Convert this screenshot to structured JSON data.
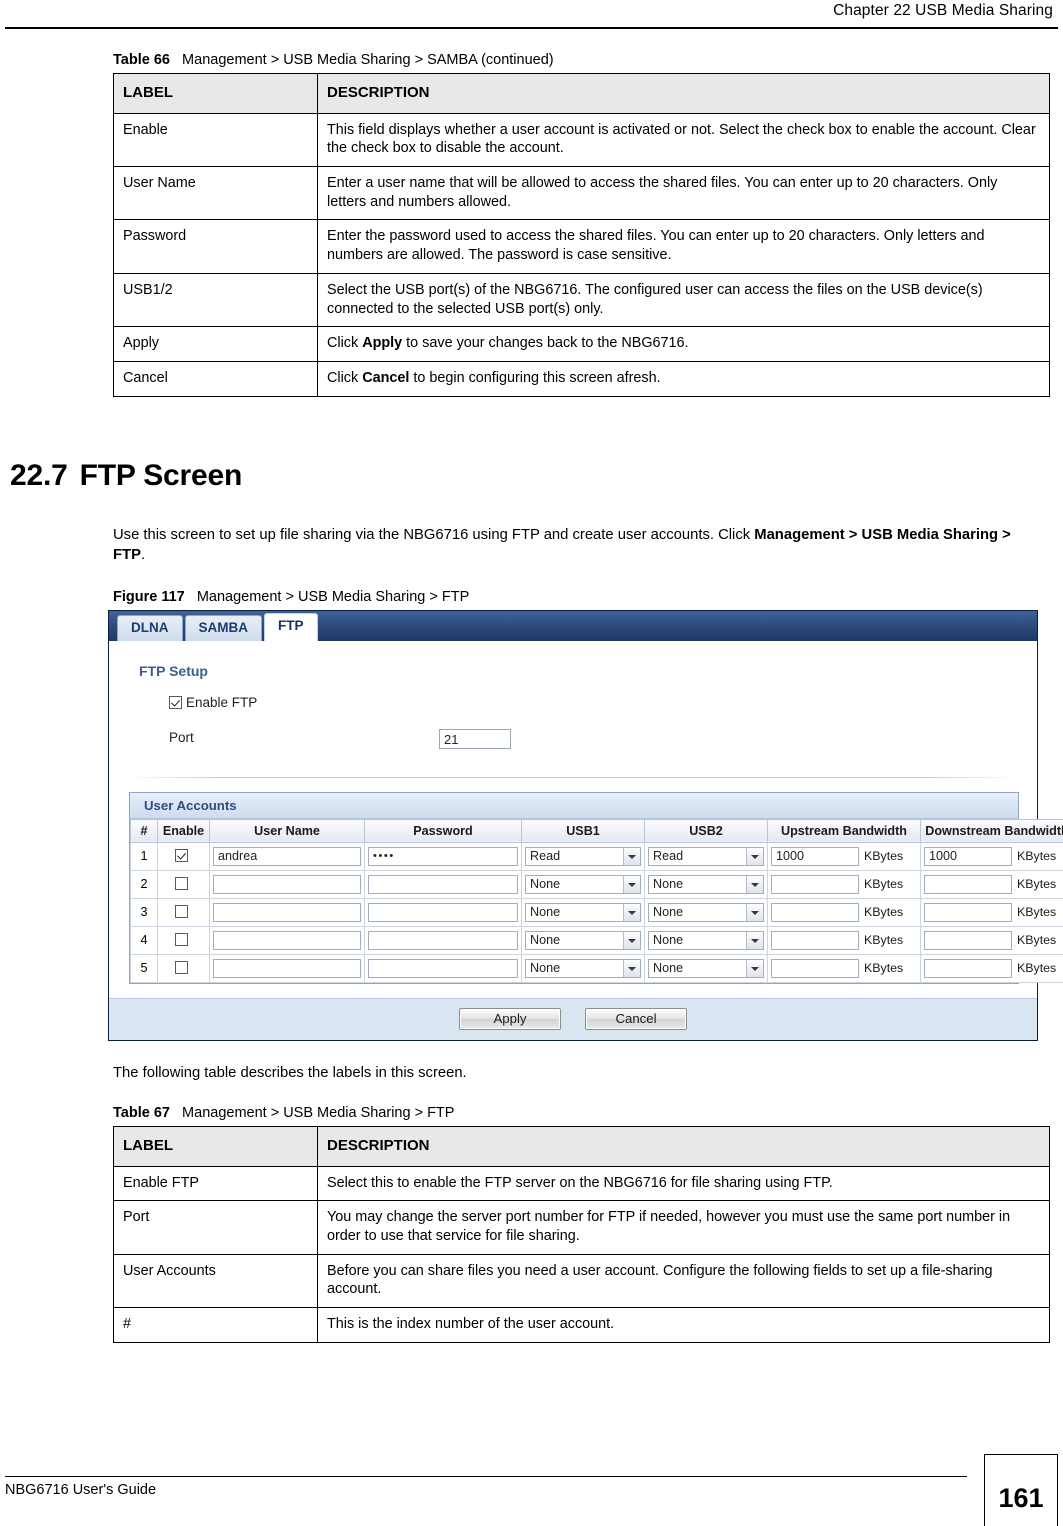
{
  "page": {
    "header_title": "Chapter 22 USB Media Sharing",
    "footer_guide": "NBG6716 User's Guide",
    "page_number": "161"
  },
  "table66": {
    "caption_label": "Table 66",
    "caption_text": "Management >  USB Media Sharing > SAMBA (continued)",
    "headers": [
      "LABEL",
      "DESCRIPTION"
    ],
    "rows": [
      {
        "label": "Enable",
        "description": "This field displays whether a user account is activated or not. Select the check box to enable the account. Clear the check box to disable the account."
      },
      {
        "label": "User Name",
        "description": "Enter a user name that will be allowed to access the shared files. You can enter up to 20 characters. Only letters and numbers allowed."
      },
      {
        "label": "Password",
        "description": "Enter the password used to access the shared files. You can enter up to 20 characters. Only letters and numbers are allowed. The password is case sensitive."
      },
      {
        "label": "USB1/2",
        "description": "Select the USB port(s) of the NBG6716. The configured user can access the files on the USB device(s) connected to the selected USB port(s) only."
      },
      {
        "label": "Apply",
        "description_pre": "Click ",
        "description_bold": "Apply",
        "description_post": " to save your changes back to the NBG6716."
      },
      {
        "label": "Cancel",
        "description_pre": "Click ",
        "description_bold": "Cancel",
        "description_post": " to begin configuring this screen afresh."
      }
    ]
  },
  "section": {
    "number": "22.7",
    "title": "FTP Screen",
    "intro_pre": "Use this screen to set up file sharing via the NBG6716 using FTP and create user accounts. Click ",
    "intro_bold": "Management >  USB Media Sharing > FTP",
    "intro_post": "."
  },
  "figure117": {
    "caption_label": "Figure 117",
    "caption_text": "Management >  USB Media Sharing > FTP"
  },
  "ui": {
    "tabs": [
      {
        "label": "DLNA",
        "active": false
      },
      {
        "label": "SAMBA",
        "active": false
      },
      {
        "label": "FTP",
        "active": true
      }
    ],
    "ftp_setup": {
      "group_title": "FTP Setup",
      "enable_label": "Enable FTP",
      "enable_checked": true,
      "port_label": "Port",
      "port_value": "21"
    },
    "user_accounts": {
      "group_title": "User Accounts",
      "columns": [
        "#",
        "Enable",
        "User Name",
        "Password",
        "USB1",
        "USB2",
        "Upstream Bandwidth",
        "Downstream Bandwidth"
      ],
      "unit_label": "KBytes",
      "rows": [
        {
          "index": "1",
          "enabled": true,
          "user_name": "andrea",
          "password": "••••",
          "usb1": "Read",
          "usb2": "Read",
          "upstream": "1000",
          "downstream": "1000"
        },
        {
          "index": "2",
          "enabled": false,
          "user_name": "",
          "password": "",
          "usb1": "None",
          "usb2": "None",
          "upstream": "",
          "downstream": ""
        },
        {
          "index": "3",
          "enabled": false,
          "user_name": "",
          "password": "",
          "usb1": "None",
          "usb2": "None",
          "upstream": "",
          "downstream": ""
        },
        {
          "index": "4",
          "enabled": false,
          "user_name": "",
          "password": "",
          "usb1": "None",
          "usb2": "None",
          "upstream": "",
          "downstream": ""
        },
        {
          "index": "5",
          "enabled": false,
          "user_name": "",
          "password": "",
          "usb1": "None",
          "usb2": "None",
          "upstream": "",
          "downstream": ""
        }
      ]
    },
    "buttons": {
      "apply": "Apply",
      "cancel": "Cancel"
    }
  },
  "after_figure_text": "The following table describes the labels in this screen.",
  "table67": {
    "caption_label": "Table 67",
    "caption_text": "Management >  USB Media Sharing > FTP",
    "headers": [
      "LABEL",
      "DESCRIPTION"
    ],
    "rows": [
      {
        "label": "Enable FTP",
        "description": "Select this to enable the FTP server on the NBG6716 for file sharing using FTP."
      },
      {
        "label": "Port",
        "description": "You may change the server port number for FTP if needed, however you must use the same port number in order to use that service for file sharing."
      },
      {
        "label": "User Accounts",
        "description": "Before you can share files you need a user account. Configure the following fields to set up a file-sharing account."
      },
      {
        "label": "#",
        "description": "This is the index number of the user account."
      }
    ]
  }
}
